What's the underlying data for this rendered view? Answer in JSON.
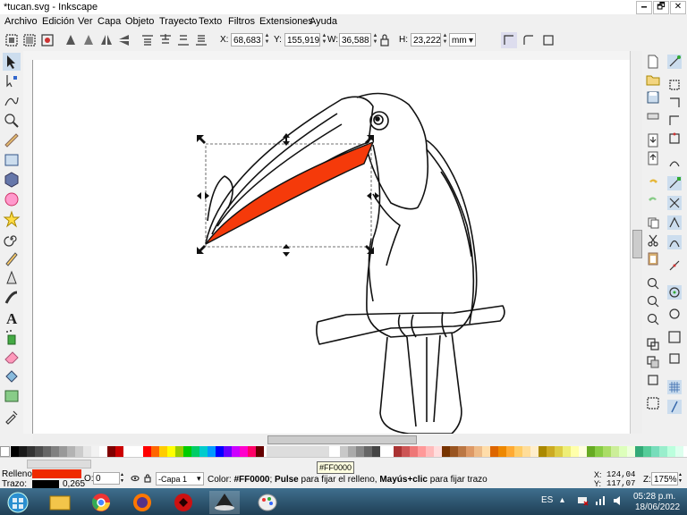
{
  "window": {
    "title": "*tucan.svg - Inkscape",
    "minimize_glyph": "🗕",
    "restore_glyph": "🗗",
    "close_glyph": "✕"
  },
  "menu": [
    "Archivo",
    "Edición",
    "Ver",
    "Capa",
    "Objeto",
    "Trayecto",
    "Texto",
    "Filtros",
    "Extensiones",
    "Ayuda"
  ],
  "toolbar": {
    "x_label": "X:",
    "x_value": "68,683",
    "y_label": "Y:",
    "y_value": "155,919",
    "w_label": "W:",
    "w_value": "36,588",
    "h_label": "H:",
    "h_value": "23,222",
    "unit": "mm"
  },
  "colors": {
    "fill": "#ff0000",
    "fill_display": "#ef2a00",
    "beak_fill": "#f53a0a",
    "accent": "#3f6f8e"
  },
  "statusbar": {
    "fill_label": "Relleno:",
    "stroke_label": "Trazo:",
    "stroke_width": "0,265",
    "opacity_label": "O:",
    "opacity_value": "0",
    "layer": "-Capa 1",
    "message_prefix": "Color: ",
    "message_color": "#FF0000",
    "message_sep": "; ",
    "message_click": "Pulse",
    "message_mid": " para fijar el relleno, ",
    "message_shift": "Mayús+clic",
    "message_end": " para fijar trazo",
    "tooltip": "#FF0000",
    "x_coord_label": "X:",
    "x_coord": "124,04",
    "y_coord_label": "Y:",
    "y_coord": "117,07",
    "zoom_label": "Z:",
    "zoom": "175%"
  },
  "taskbar": {
    "language": "ES",
    "time": "05:28 p.m.",
    "date": "18/06/2022"
  },
  "icons": {
    "tools": [
      "selector-arrow-icon",
      "node-editor-icon",
      "tweak-icon",
      "zoom-icon",
      "measure-icon",
      "rectangle-icon",
      "3d-box-icon",
      "ellipse-icon",
      "star-icon",
      "spiral-icon",
      "pencil-icon",
      "pen-icon",
      "calligraphy-icon",
      "text-icon",
      "spray-icon",
      "eraser-icon",
      "paint-bucket-icon",
      "gradient-icon",
      "dropper-icon"
    ]
  }
}
